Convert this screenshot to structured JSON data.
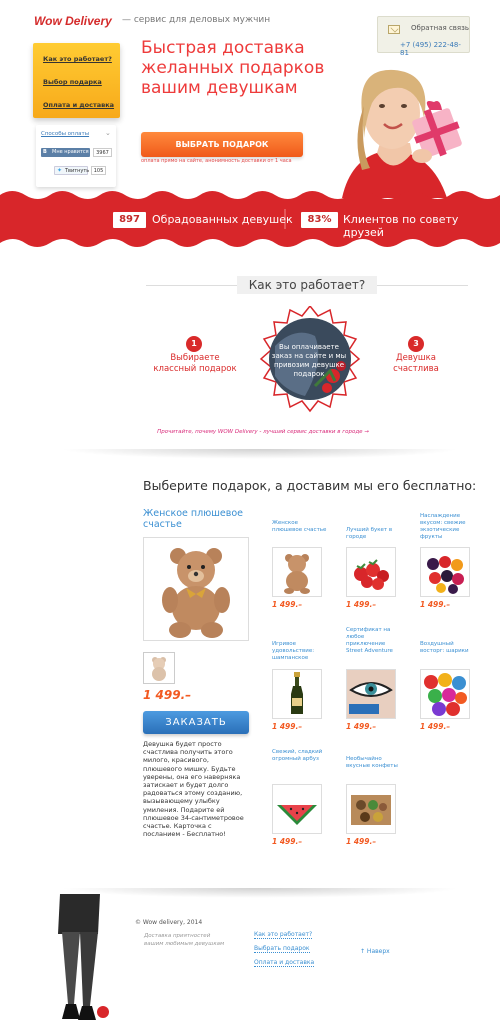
{
  "header": {
    "logo": "Wow Delivery",
    "tagline": "— сервис для деловых мужчин",
    "feedback_label": "Обратная связь",
    "phone": "+7 (495) 222-48-81"
  },
  "menu": {
    "items": [
      "Как это работает?",
      "Выбор подарка",
      "Оплата и доставка"
    ]
  },
  "social": {
    "payment_methods": "Способы оплаты",
    "vk_label": "Мне нравится",
    "vk_count": "3967",
    "twitter_label": "Твитнуть",
    "twitter_count": "105"
  },
  "hero": {
    "title": "Быстрая доставка желанных подарков вашим девушкам",
    "cta": "ВЫБРАТЬ ПОДАРОК",
    "note": "оплата прямо на сайте, анонимность доставки от 1 часа"
  },
  "stats": [
    {
      "value": "897",
      "label": "Обрадованных девушек"
    },
    {
      "value": "83%",
      "label": "Клиентов по совету друзей"
    }
  ],
  "how": {
    "title": "Как это работает?",
    "steps": [
      {
        "num": "1",
        "text": "Выбираете классный подарок"
      },
      {
        "num": "2",
        "text": "Вы оплачиваете заказ на сайте и мы привозим девушке подарок"
      },
      {
        "num": "3",
        "text": "Девушка счастлива"
      }
    ],
    "link": "Прочитайте, почему WOW Delivery - лучший сервис доставки в городе →"
  },
  "products": {
    "heading": "Выберите подарок, а доставим мы его бесплатно:",
    "featured": {
      "name": "Женское плюшевое счастье",
      "price": "1 499.–",
      "order": "ЗАКАЗАТЬ",
      "description": "Девушка будет просто счастлива получить этого милого, красивого, плюшевого мишку. Будьте уверены, она его наверняка затискает и будет долго радоваться этому созданию, вызывающему улыбку умиления. Подарите ей плюшевое 34-сантиметровое счастье. Карточка с посланием - Бесплатно!"
    },
    "items": [
      {
        "name": "Женское плюшевое счастье",
        "price": "1 499.–",
        "icon": "teddy-bear"
      },
      {
        "name": "Лучший букет в городе",
        "price": "1 499.–",
        "icon": "strawberries"
      },
      {
        "name": "Наслаждение вкусом: свежие экзотические фрукты",
        "price": "1 499.–",
        "icon": "berries"
      },
      {
        "name": "Игривое удовольствие: шампанское",
        "price": "1 499.–",
        "icon": "champagne"
      },
      {
        "name": "Сертификат на любое приключение Street Adventure",
        "price": "1 499.–",
        "icon": "eye-certificate"
      },
      {
        "name": "Воздушный восторг: шарики",
        "price": "1 499.–",
        "icon": "balloons"
      },
      {
        "name": "Свежий, сладкий огромный арбуз",
        "price": "1 499.–",
        "icon": "watermelon"
      },
      {
        "name": "Необычайно вкусные конфеты",
        "price": "1 499.–",
        "icon": "candies"
      }
    ]
  },
  "footer": {
    "copyright": "© Wow delivery, 2014",
    "tagline": "Доставка приятностей вашим любимым девушкам",
    "links": [
      "Как это работает?",
      "Выбрать подарок",
      "Оплата и доставка"
    ],
    "top": "↑ Наверх"
  },
  "colors": {
    "accent_red": "#d92a2a",
    "cta_orange": "#f0591a",
    "link_blue": "#3a8fd2",
    "menu_yellow": "#f7a91a"
  }
}
